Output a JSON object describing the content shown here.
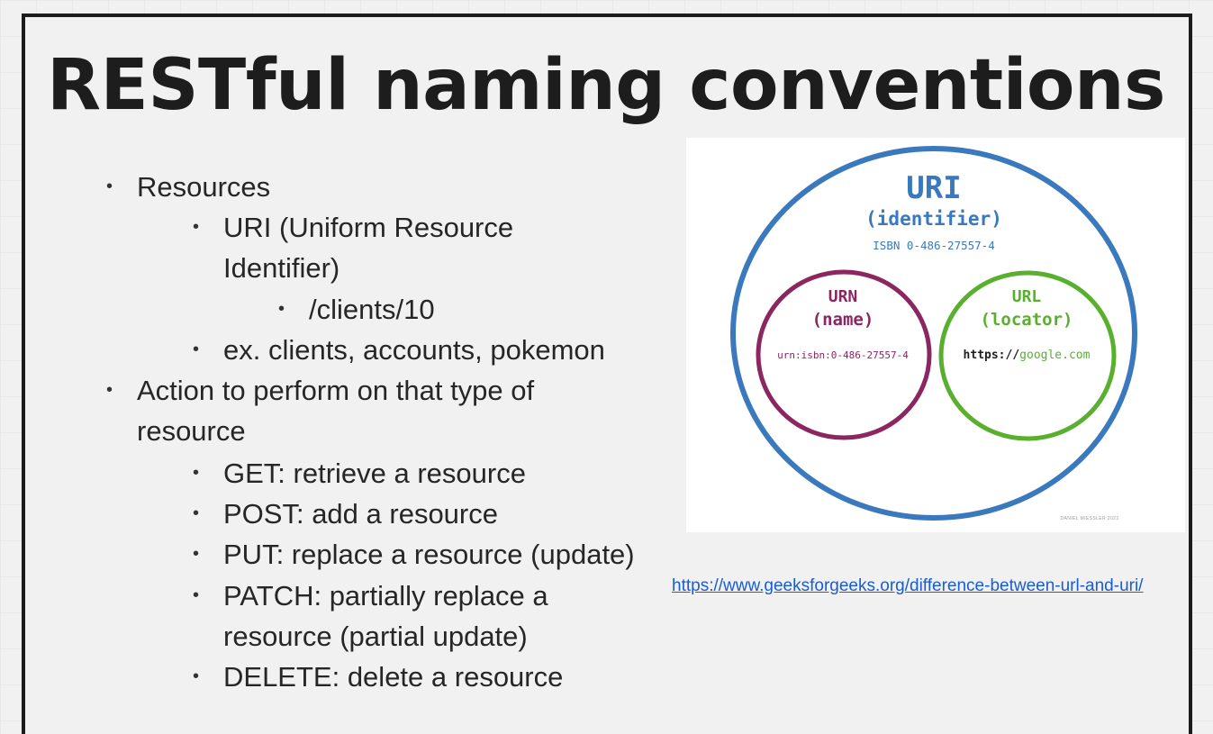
{
  "slide": {
    "title": "RESTful naming conventions",
    "bullets": [
      {
        "text": "Resources"
      },
      {
        "text": "URI (Uniform Resource"
      },
      {
        "text": "Identifier)"
      },
      {
        "text": "/clients/10"
      },
      {
        "text": "ex. clients, accounts, pokemon"
      },
      {
        "text": "Action to perform on that type of"
      },
      {
        "text": "resource"
      },
      {
        "text": "GET: retrieve a resource"
      },
      {
        "text": "POST: add a resource"
      },
      {
        "text": "PUT: replace a resource (update)"
      },
      {
        "text": "PATCH: partially replace a"
      },
      {
        "text": "resource (partial update)"
      },
      {
        "text": "DELETE: delete a resource"
      }
    ]
  },
  "diagram": {
    "uri": {
      "title": "URI",
      "subtitle": "(identifier)",
      "example": "ISBN 0-486-27557-4",
      "color": "#3a79bd"
    },
    "urn": {
      "title": "URN",
      "subtitle": "(name)",
      "example": "urn:isbn:0-486-27557-4",
      "color": "#8b2660"
    },
    "url": {
      "title": "URL",
      "subtitle": "(locator)",
      "example_scheme": "https://",
      "example_host": "google.com",
      "color": "#58b02e"
    },
    "credit": "DANIEL MIESSLER 2022"
  },
  "link": {
    "text": "https://www.geeksforgeeks.org/difference-between-url-and-uri/"
  }
}
